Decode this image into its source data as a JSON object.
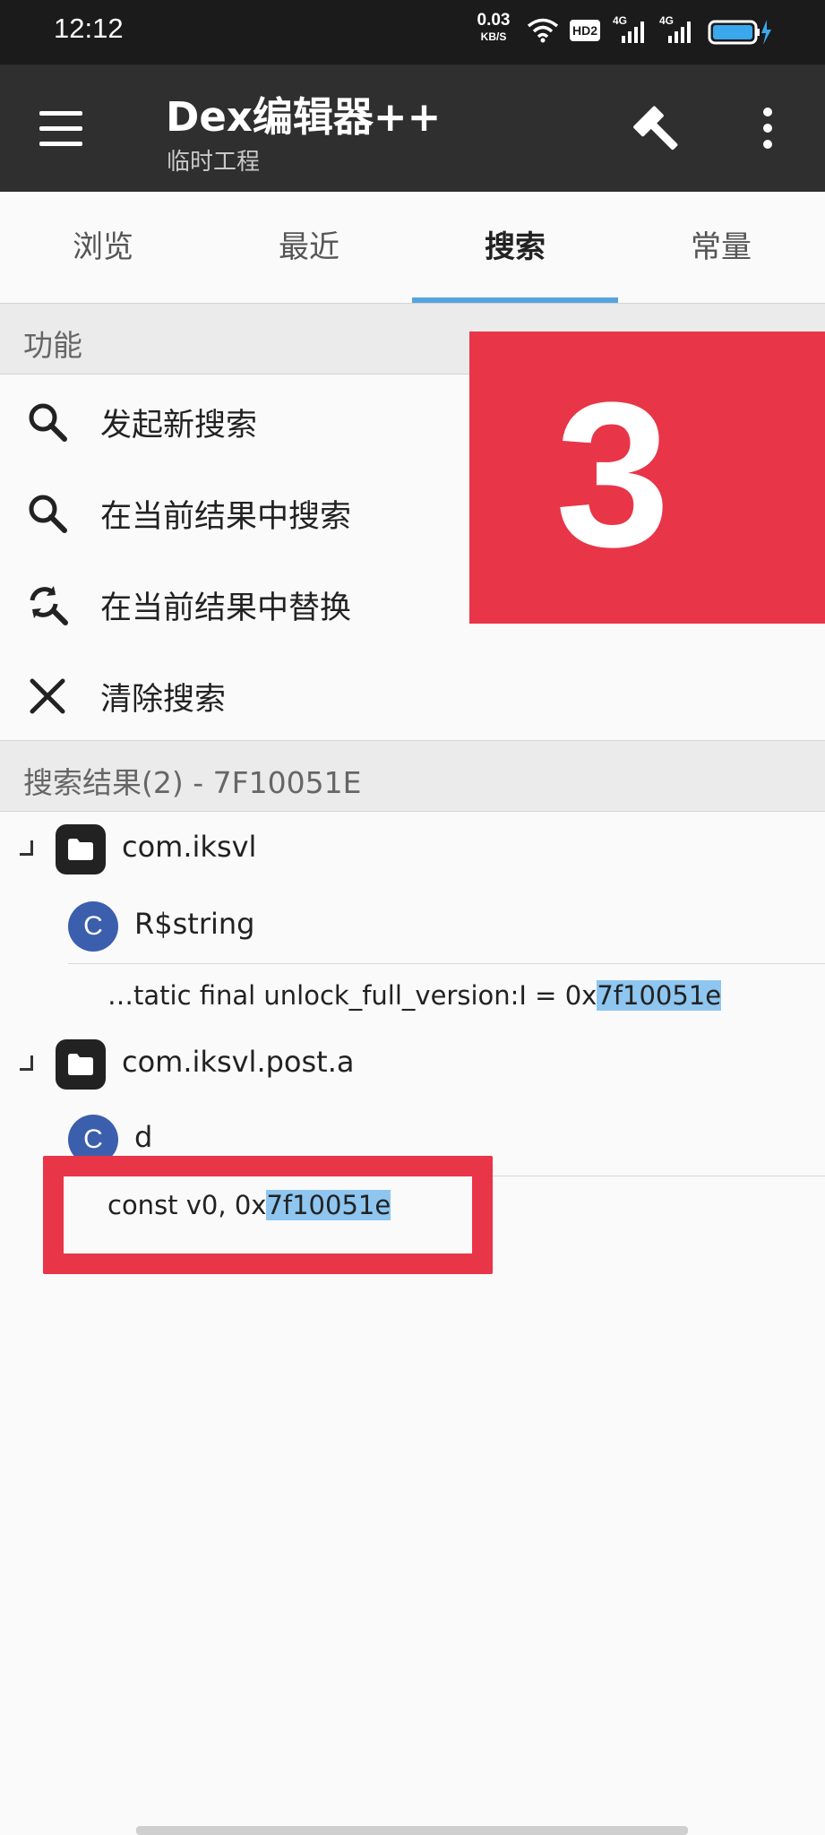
{
  "status_bar": {
    "time": "12:12",
    "speed_value": "0.03",
    "speed_unit": "KB/S",
    "hd_label": "HD2",
    "net1": "4G",
    "net2": "4G"
  },
  "app_bar": {
    "title": "Dex编辑器++",
    "subtitle": "临时工程"
  },
  "tabs": [
    {
      "label": "浏览",
      "active": false
    },
    {
      "label": "最近",
      "active": false
    },
    {
      "label": "搜索",
      "active": true
    },
    {
      "label": "常量",
      "active": false
    }
  ],
  "functions_section": {
    "header": "功能",
    "items": [
      {
        "label": "发起新搜索",
        "icon": "search-icon"
      },
      {
        "label": "在当前结果中搜索",
        "icon": "search-icon"
      },
      {
        "label": "在当前结果中替换",
        "icon": "replace-icon"
      },
      {
        "label": "清除搜索",
        "icon": "close-icon"
      }
    ]
  },
  "overlay_number": "3",
  "results_section": {
    "header": "搜索结果(2) - 7F10051E",
    "groups": [
      {
        "package": "com.iksvl",
        "class_badge": "C",
        "class_name": "R$string",
        "match_prefix": "…tatic final unlock_full_version:I = 0x",
        "match_highlight": "7f10051e"
      },
      {
        "package": "com.iksvl.post.a",
        "class_badge": "C",
        "class_name": "d",
        "match_prefix": "const v0, 0x",
        "match_highlight": "7f10051e"
      }
    ]
  },
  "colors": {
    "app_bar": "#2f2f2f",
    "tab_indicator": "#56a4dc",
    "annotation_red": "#e93548",
    "class_badge": "#3b5fad",
    "highlight": "#8ec6f0"
  }
}
